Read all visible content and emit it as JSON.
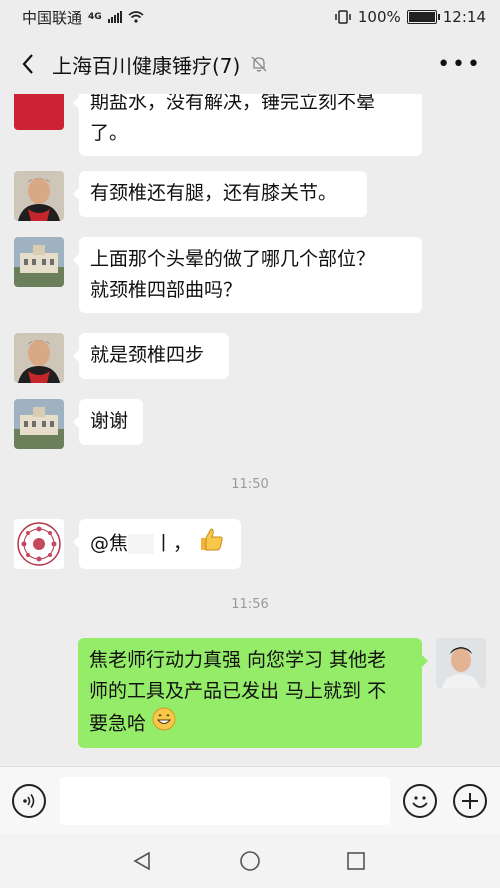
{
  "status_bar": {
    "carrier": "中国联通",
    "network": "4G",
    "battery": "100%",
    "battery_level": 1.0,
    "time": "12:14"
  },
  "header": {
    "title": "上海百川健康锤疗(7)"
  },
  "messages": [
    {
      "side": "in",
      "avatar": "man-red-scarf-avatar",
      "lines": [
        "期盐水，没有解决，锤完立刻不晕",
        "了。"
      ]
    },
    {
      "side": "in",
      "avatar": "man-red-scarf-avatar",
      "lines": [
        "有颈椎还有腿，还有膝关节。"
      ]
    },
    {
      "side": "in",
      "avatar": "building-avatar",
      "lines": [
        "上面那个头晕的做了哪几个部位？",
        "就颈椎四部曲吗？"
      ]
    },
    {
      "side": "in",
      "avatar": "man-red-scarf-avatar",
      "lines": [
        "就是颈椎四步"
      ]
    },
    {
      "side": "in",
      "avatar": "building-avatar",
      "lines": [
        "谢谢"
      ]
    },
    {
      "side": "in",
      "avatar": "emblem-avatar",
      "lines": [
        "@焦",
        "丨，"
      ]
    },
    {
      "side": "out",
      "avatar": "young-man-avatar",
      "lines": [
        "焦老师行动力真强 向您学习 其他老",
        "师的工具及产品已发出 马上就到 不",
        "要急哈"
      ]
    }
  ],
  "timestamps": [
    "11:50",
    "11:56"
  ],
  "colors": {
    "chat_background": "#ededed",
    "incoming_bubble": "#ffffff",
    "outgoing_bubble": "#95ec69"
  }
}
